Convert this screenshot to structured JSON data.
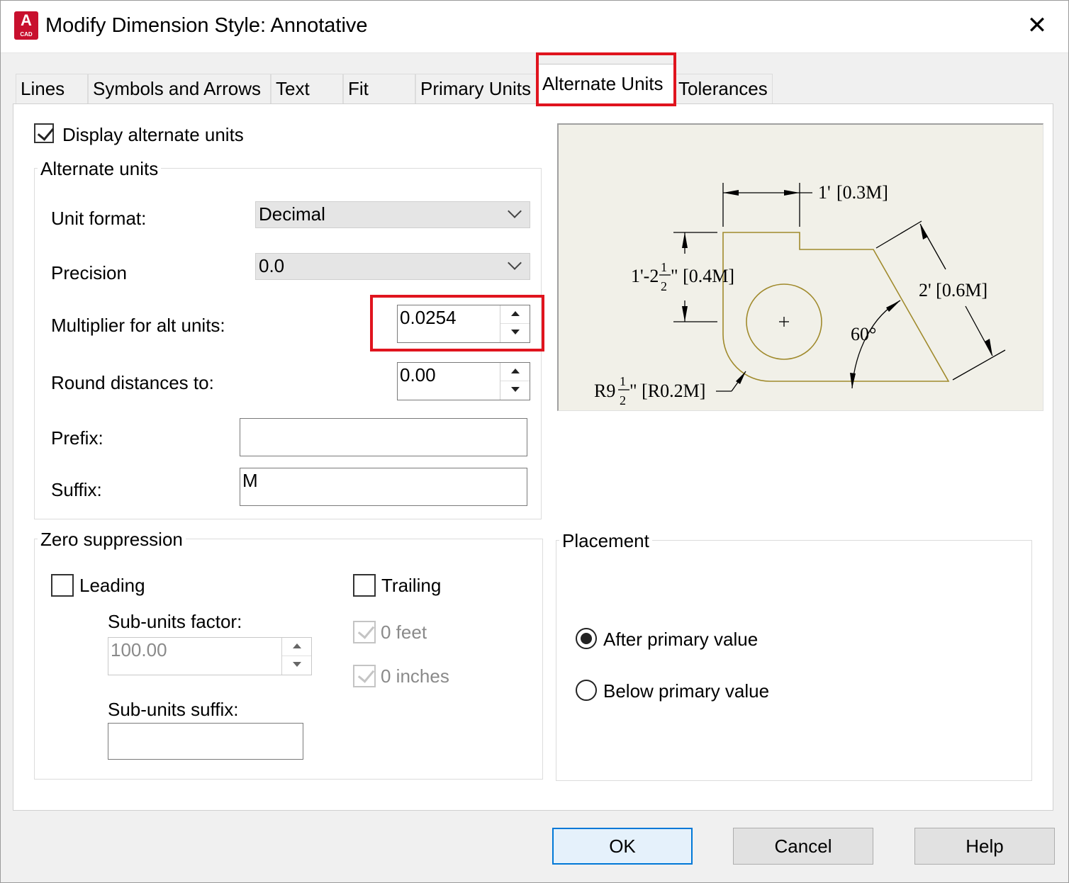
{
  "window": {
    "title": "Modify Dimension Style: Annotative",
    "app_icon_letter": "A",
    "app_icon_sub": "CAD",
    "close_glyph": "✕"
  },
  "tabs": [
    {
      "label": "Lines"
    },
    {
      "label": "Symbols and Arrows"
    },
    {
      "label": "Text"
    },
    {
      "label": "Fit"
    },
    {
      "label": "Primary Units"
    },
    {
      "label": "Alternate Units",
      "active": true
    },
    {
      "label": "Tolerances"
    }
  ],
  "display_alt": {
    "label": "Display alternate units",
    "checked": true
  },
  "alt_units": {
    "legend": "Alternate units",
    "unit_format": {
      "label": "Unit format:",
      "value": "Decimal"
    },
    "precision": {
      "label": "Precision",
      "value": "0.0"
    },
    "multiplier": {
      "label": "Multiplier for alt units:",
      "value": "0.0254"
    },
    "round": {
      "label": "Round distances  to:",
      "value": "0.00"
    },
    "prefix": {
      "label": "Prefix:",
      "value": ""
    },
    "suffix": {
      "label": "Suffix:",
      "value": "M"
    }
  },
  "zero_suppression": {
    "legend": "Zero suppression",
    "leading": {
      "label": "Leading",
      "checked": false
    },
    "trailing": {
      "label": "Trailing",
      "checked": false
    },
    "sub_units_factor": {
      "label": "Sub-units factor:",
      "value": "100.00"
    },
    "sub_units_suffix": {
      "label": "Sub-units suffix:",
      "value": ""
    },
    "zero_feet": {
      "label": "0 feet",
      "checked": true,
      "disabled": true
    },
    "zero_inches": {
      "label": "0 inches",
      "checked": true,
      "disabled": true
    }
  },
  "placement": {
    "legend": "Placement",
    "after": {
      "label": "After primary value",
      "selected": true
    },
    "below": {
      "label": "Below primary value",
      "selected": false
    }
  },
  "preview": {
    "dim_top_a": "1'",
    "dim_top_b": "[0.3M]",
    "dim_left_a": "1'-2",
    "dim_left_b": "\" [0.4M]",
    "dim_right": "2' [0.6M]",
    "angle": "60°",
    "radius_a": "R9",
    "radius_b": "\" [R0.2M]",
    "frac_num": "1",
    "frac_den": "2",
    "colors": {
      "background": "#f1f0e8",
      "outline": "#a08a2c"
    }
  },
  "buttons": {
    "ok": "OK",
    "cancel": "Cancel",
    "help": "Help"
  }
}
